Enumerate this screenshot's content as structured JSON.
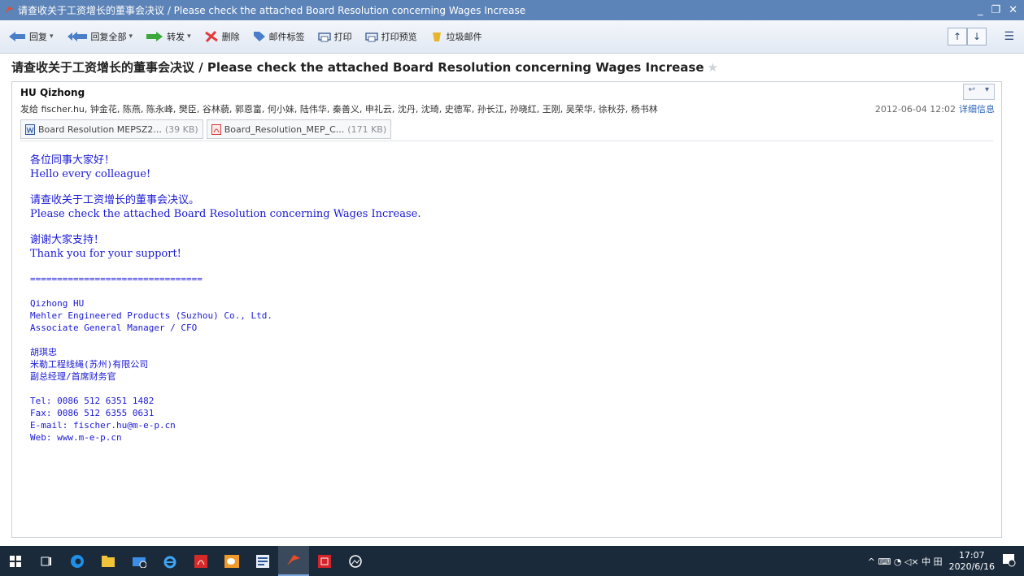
{
  "window": {
    "title": "请查收关于工资增长的董事会决议 / Please check the attached Board Resolution concerning Wages Increase",
    "controls": [
      "_",
      "❐",
      "✕"
    ]
  },
  "toolbar": {
    "reply": "回复",
    "reply_all": "回复全部",
    "forward": "转发",
    "delete": "删除",
    "tag": "邮件标签",
    "print": "打印",
    "print_preview": "打印预览",
    "junk": "垃圾邮件",
    "up": "↑",
    "down": "↓",
    "menu": "☰"
  },
  "message": {
    "subject": "请查收关于工资增长的董事会决议 / Please check the attached Board Resolution concerning Wages Increase",
    "star": "★",
    "sender": "HU Qizhong",
    "recipients": "发给 fischer.hu, 钟金花, 陈燕, 陈永峰, 樊臣, 谷林藐, 郭恩富, 何小妹, 陆伟华, 秦善义, 申礼云, 沈丹, 沈琦, 史德军, 孙长江, 孙晓红, 王刚, 吴荣华, 徐秋芬, 杨书林",
    "date": "2012-06-04 12:02",
    "details_link": "详细信息",
    "reply_ctl": [
      "↩",
      "▾"
    ],
    "attachments": [
      {
        "name": "Board Resolution MEPSZ2...",
        "size": "(39 KB)"
      },
      {
        "name": "Board_Resolution_MEP_C...",
        "size": "(171 KB)"
      }
    ],
    "body": {
      "greet_zh": "各位同事大家好！",
      "greet_en": "Hello every colleague!",
      "check_zh": "请查收关于工资增长的董事会决议。",
      "check_en": "Please check the attached Board Resolution concerning Wages Increase.",
      "thanks_zh": "谢谢大家支持！",
      "thanks_en": "Thank you for your support!",
      "separator": "================================",
      "sig_name_en": "Qizhong HU",
      "sig_company_en": "Mehler Engineered Products (Suzhou) Co., Ltd.",
      "sig_title_en": "Associate General Manager / CFO",
      "sig_name_zh": "胡琪忠",
      "sig_company_zh": "米勒工程线绳(苏州)有限公司",
      "sig_title_zh": "副总经理/首席财务官",
      "tel": "Tel: 0086 512 6351 1482",
      "fax": "Fax: 0086 512 6355 0631",
      "email": "E-mail:  fischer.hu@m-e-p.cn",
      "web": "Web:  www.m-e-p.cn"
    }
  },
  "taskbar": {
    "tray_icons": "^ ⌨ ◔ ◁× 中 田",
    "time": "17:07",
    "date": "2020/6/16",
    "notify_badge": "1"
  }
}
